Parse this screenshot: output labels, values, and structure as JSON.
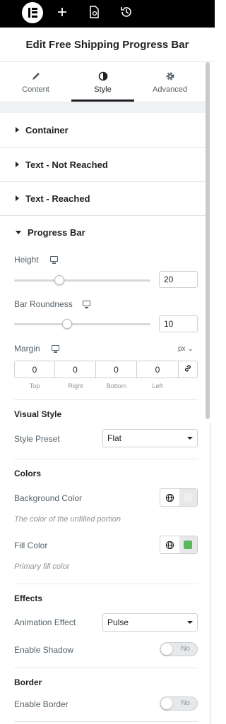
{
  "panel": {
    "title": "Edit Free Shipping Progress Bar",
    "tabs": [
      {
        "label": "Content",
        "icon": "pencil-icon"
      },
      {
        "label": "Style",
        "icon": "half-circle-icon",
        "active": true
      },
      {
        "label": "Advanced",
        "icon": "gear-icon"
      }
    ]
  },
  "sections": [
    {
      "label": "Container",
      "open": false
    },
    {
      "label": "Text - Not Reached",
      "open": false
    },
    {
      "label": "Text - Reached",
      "open": false
    },
    {
      "label": "Progress Bar",
      "open": true
    }
  ],
  "progress_bar": {
    "height": {
      "label": "Height",
      "value": "20",
      "slider_fraction": 0.33
    },
    "roundness": {
      "label": "Bar Roundness",
      "value": "10",
      "slider_fraction": 0.39
    },
    "margin": {
      "label": "Margin",
      "unit": "px",
      "fields": [
        {
          "value": "0",
          "label": "Top"
        },
        {
          "value": "0",
          "label": "Right"
        },
        {
          "value": "0",
          "label": "Bottom"
        },
        {
          "value": "0",
          "label": "Left"
        }
      ]
    }
  },
  "visual_style": {
    "heading": "Visual Style",
    "preset_label": "Style Preset",
    "preset_value": "Flat"
  },
  "colors": {
    "heading": "Colors",
    "background": {
      "label": "Background Color",
      "hint": "The color of the unfilled portion",
      "swatch": "#eeeeee"
    },
    "fill": {
      "label": "Fill Color",
      "hint": "Primary fill color",
      "swatch": "#5cb85c"
    }
  },
  "effects": {
    "heading": "Effects",
    "animation_label": "Animation Effect",
    "animation_value": "Pulse",
    "shadow_label": "Enable Shadow",
    "shadow_state": "No"
  },
  "border": {
    "heading": "Border",
    "enable_label": "Enable Border",
    "enable_state": "No"
  }
}
